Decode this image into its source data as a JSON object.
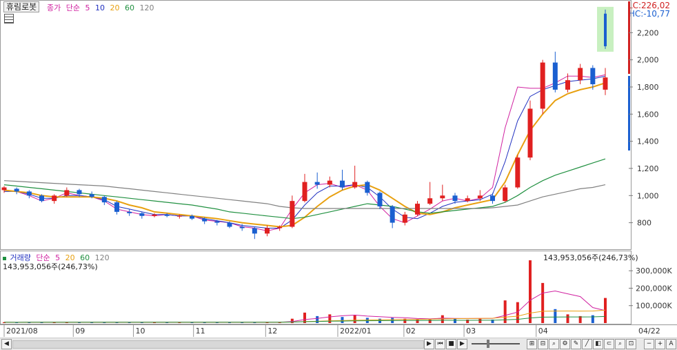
{
  "header": {
    "stock_name": "휴림로봇",
    "price_legend": [
      "종가",
      "단순",
      "5",
      "10",
      "20",
      "60",
      "120"
    ],
    "lc_label": "LC:226,02",
    "hc_label": "HC:-10,77"
  },
  "volume_header": {
    "legend": [
      "거래량",
      "단순",
      "5",
      "20",
      "60",
      "120"
    ],
    "info_left": "143,953,056주(246,73%)",
    "info_right": "143,953,056주(246,73%)"
  },
  "axes": {
    "price_ticks": [
      "2,200",
      "2,000",
      "1,800",
      "1,600",
      "1,400",
      "1,200",
      "1,000",
      "800"
    ],
    "volume_ticks": [
      "300,000K",
      "200,000K",
      "100,000K"
    ],
    "date_ticks": [
      "2021/08",
      "09",
      "10",
      "11",
      "12",
      "2022/01",
      "02",
      "03",
      "04"
    ],
    "current_date": "04/22"
  },
  "colors": {
    "up": "#e02020",
    "down": "#1a5fd0",
    "ma5": "#d020a0",
    "ma10": "#2030c0",
    "ma20": "#e8a010",
    "ma60": "#209040",
    "ma120": "#808080",
    "highlight": "#c8f0c0"
  },
  "scrollbar_icons": [
    "scroll-left-icon",
    "scroll-right-icon",
    "first-icon",
    "prev-icon",
    "stop-icon",
    "next-icon",
    "zoom-icon",
    "plus-icon",
    "minus-icon",
    "text-icon"
  ],
  "chart_data": {
    "type": "candlestick",
    "x_range": [
      "2021/08",
      "2022/04/22"
    ],
    "price_ylim": [
      620,
      2400
    ],
    "volume_ylim": [
      0,
      380000
    ],
    "series": [
      {
        "name": "5",
        "values": [
          1040,
          1030,
          1000,
          960,
          980,
          1020,
          1000,
          990,
          960,
          900,
          880,
          860,
          850,
          860,
          850,
          850,
          820,
          810,
          800,
          770,
          760,
          740,
          760,
          900,
          1020,
          1080,
          1090,
          1060,
          1080,
          1040,
          920,
          830,
          800,
          850,
          900,
          960,
          980,
          960,
          980,
          1060,
          1500,
          1800,
          1790,
          1790,
          1830,
          1880,
          1880,
          1870,
          1890
        ]
      },
      {
        "name": "10",
        "values": [
          1030,
          1030,
          1010,
          980,
          980,
          1000,
          1000,
          990,
          970,
          920,
          900,
          880,
          860,
          860,
          850,
          850,
          830,
          815,
          800,
          780,
          770,
          760,
          760,
          820,
          930,
          1020,
          1070,
          1070,
          1080,
          1060,
          990,
          900,
          840,
          830,
          870,
          920,
          950,
          960,
          970,
          1010,
          1250,
          1550,
          1730,
          1780,
          1810,
          1840,
          1850,
          1860,
          1880
        ]
      },
      {
        "name": "20",
        "values": [
          1040,
          1030,
          1020,
          1000,
          990,
          990,
          990,
          990,
          980,
          960,
          930,
          910,
          880,
          870,
          860,
          850,
          840,
          830,
          815,
          800,
          790,
          780,
          770,
          780,
          840,
          920,
          990,
          1040,
          1070,
          1080,
          1040,
          980,
          920,
          870,
          860,
          880,
          910,
          930,
          950,
          970,
          1100,
          1300,
          1480,
          1600,
          1700,
          1750,
          1780,
          1800,
          1830
        ]
      },
      {
        "name": "60",
        "values": [
          1080,
          1070,
          1060,
          1050,
          1040,
          1030,
          1020,
          1010,
          1000,
          990,
          980,
          970,
          960,
          950,
          940,
          930,
          915,
          900,
          880,
          870,
          860,
          850,
          840,
          830,
          840,
          860,
          880,
          900,
          920,
          940,
          930,
          920,
          900,
          880,
          870,
          880,
          890,
          900,
          910,
          920,
          950,
          1000,
          1060,
          1110,
          1150,
          1180,
          1210,
          1240,
          1270
        ]
      },
      {
        "name": "120",
        "values": [
          1110,
          1105,
          1100,
          1095,
          1090,
          1085,
          1080,
          1075,
          1070,
          1060,
          1050,
          1040,
          1030,
          1020,
          1010,
          1000,
          990,
          980,
          970,
          960,
          950,
          940,
          920,
          910,
          905,
          905,
          905,
          905,
          905,
          905,
          905,
          905,
          905,
          905,
          905,
          905,
          905,
          905,
          905,
          910,
          920,
          930,
          960,
          990,
          1010,
          1030,
          1050,
          1060,
          1080
        ]
      }
    ],
    "candles": [
      {
        "o": 1040,
        "c": 1060,
        "h": 1070,
        "l": 1020
      },
      {
        "o": 1050,
        "c": 1030,
        "h": 1060,
        "l": 1010
      },
      {
        "o": 1030,
        "c": 1000,
        "h": 1040,
        "l": 980
      },
      {
        "o": 1000,
        "c": 960,
        "h": 1010,
        "l": 950
      },
      {
        "o": 960,
        "c": 1000,
        "h": 1010,
        "l": 940
      },
      {
        "o": 1000,
        "c": 1040,
        "h": 1060,
        "l": 990
      },
      {
        "o": 1040,
        "c": 1010,
        "h": 1050,
        "l": 990
      },
      {
        "o": 1010,
        "c": 990,
        "h": 1030,
        "l": 980
      },
      {
        "o": 990,
        "c": 950,
        "h": 1000,
        "l": 930
      },
      {
        "o": 950,
        "c": 880,
        "h": 960,
        "l": 860
      },
      {
        "o": 880,
        "c": 870,
        "h": 900,
        "l": 850
      },
      {
        "o": 870,
        "c": 850,
        "h": 880,
        "l": 830
      },
      {
        "o": 850,
        "c": 860,
        "h": 870,
        "l": 840
      },
      {
        "o": 860,
        "c": 850,
        "h": 870,
        "l": 840
      },
      {
        "o": 850,
        "c": 850,
        "h": 860,
        "l": 830
      },
      {
        "o": 850,
        "c": 830,
        "h": 860,
        "l": 820
      },
      {
        "o": 830,
        "c": 810,
        "h": 840,
        "l": 790
      },
      {
        "o": 810,
        "c": 800,
        "h": 820,
        "l": 780
      },
      {
        "o": 800,
        "c": 770,
        "h": 810,
        "l": 760
      },
      {
        "o": 770,
        "c": 760,
        "h": 790,
        "l": 740
      },
      {
        "o": 760,
        "c": 720,
        "h": 770,
        "l": 680
      },
      {
        "o": 720,
        "c": 760,
        "h": 780,
        "l": 700
      },
      {
        "o": 760,
        "c": 770,
        "h": 780,
        "l": 740
      },
      {
        "o": 770,
        "c": 960,
        "h": 1000,
        "l": 760
      },
      {
        "o": 960,
        "c": 1100,
        "h": 1160,
        "l": 950
      },
      {
        "o": 1100,
        "c": 1080,
        "h": 1170,
        "l": 1050
      },
      {
        "o": 1080,
        "c": 1110,
        "h": 1140,
        "l": 1060
      },
      {
        "o": 1110,
        "c": 1060,
        "h": 1190,
        "l": 1040
      },
      {
        "o": 1060,
        "c": 1100,
        "h": 1220,
        "l": 1050
      },
      {
        "o": 1100,
        "c": 1020,
        "h": 1110,
        "l": 1000
      },
      {
        "o": 1020,
        "c": 920,
        "h": 1030,
        "l": 900
      },
      {
        "o": 920,
        "c": 800,
        "h": 930,
        "l": 760
      },
      {
        "o": 800,
        "c": 860,
        "h": 880,
        "l": 780
      },
      {
        "o": 860,
        "c": 940,
        "h": 960,
        "l": 850
      },
      {
        "o": 940,
        "c": 980,
        "h": 1100,
        "l": 930
      },
      {
        "o": 980,
        "c": 1000,
        "h": 1080,
        "l": 960
      },
      {
        "o": 1000,
        "c": 960,
        "h": 1020,
        "l": 940
      },
      {
        "o": 960,
        "c": 980,
        "h": 1000,
        "l": 950
      },
      {
        "o": 980,
        "c": 1000,
        "h": 1040,
        "l": 960
      },
      {
        "o": 1000,
        "c": 960,
        "h": 1020,
        "l": 940
      },
      {
        "o": 960,
        "c": 1060,
        "h": 1080,
        "l": 950
      },
      {
        "o": 1060,
        "c": 1280,
        "h": 1300,
        "l": 1050
      },
      {
        "o": 1280,
        "c": 1640,
        "h": 1700,
        "l": 1260
      },
      {
        "o": 1640,
        "c": 1980,
        "h": 2000,
        "l": 1600
      },
      {
        "o": 1980,
        "c": 1780,
        "h": 2060,
        "l": 1760
      },
      {
        "o": 1780,
        "c": 1850,
        "h": 1900,
        "l": 1760
      },
      {
        "o": 1850,
        "c": 1940,
        "h": 1970,
        "l": 1820
      },
      {
        "o": 1940,
        "c": 1820,
        "h": 1960,
        "l": 1780
      },
      {
        "o": 1780,
        "c": 1870,
        "h": 1940,
        "l": 1740
      }
    ],
    "volumes": [
      5000,
      4000,
      6000,
      5000,
      4000,
      6000,
      5000,
      4000,
      6000,
      5000,
      4000,
      6000,
      5000,
      4000,
      6000,
      5000,
      4000,
      6000,
      5000,
      4000,
      6000,
      5000,
      4000,
      25000,
      60000,
      40000,
      50000,
      35000,
      45000,
      30000,
      25000,
      30000,
      25000,
      20000,
      20000,
      45000,
      25000,
      20000,
      25000,
      20000,
      130000,
      120000,
      360000,
      230000,
      80000,
      50000,
      40000,
      45000,
      143953
    ],
    "highlight_candle": {
      "o": 2100,
      "c": 2340,
      "h": 2370,
      "l": 2080
    }
  }
}
